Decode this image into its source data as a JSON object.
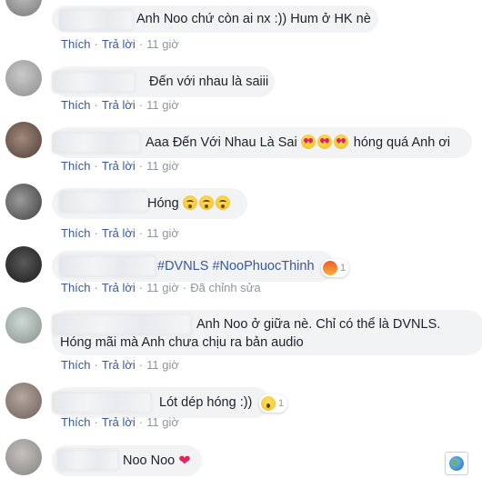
{
  "common": {
    "like_label": "Thích",
    "reply_label": "Trả lời",
    "separator": "·"
  },
  "comments": [
    {
      "text": "Anh Noo chứ còn ai nx :)) Hum ở HK nè",
      "time": "11 giờ"
    },
    {
      "text": "Đến với nhau là saiii",
      "time": "11 giờ"
    },
    {
      "text": "Aaa Đến Với Nhau Là Sai",
      "emoji": [
        "heart-eyes",
        "heart-eyes",
        "heart-eyes"
      ],
      "text_after": "hóng quá Anh ơi",
      "time": "11 giờ"
    },
    {
      "text": "Hóng",
      "emoji": [
        "crying-face",
        "crying-face",
        "crying-face"
      ],
      "time": "11 giờ"
    },
    {
      "hashtags": [
        "#DVNLS",
        "#NooPhuocThinh"
      ],
      "reaction": {
        "type": "angry",
        "count": "1"
      },
      "time": "11 giờ",
      "edited": "Đã chỉnh sửa"
    },
    {
      "text_line1": "Anh Noo ở giữa nè. Chỉ có thể là DVNLS.",
      "text_line2": "Hóng mãi mà Anh chưa chịu ra bản audio",
      "time": "11 giờ"
    },
    {
      "text": "Lót dép hóng :))",
      "reaction": {
        "type": "wow",
        "count": "1"
      },
      "time": "11 giờ"
    },
    {
      "text": "Noo Noo",
      "emoji": [
        "red-heart"
      ]
    }
  ],
  "colors": {
    "link": "#385898",
    "meta": "#90949c",
    "bubble": "#f2f3f5",
    "text": "#1d2129"
  }
}
